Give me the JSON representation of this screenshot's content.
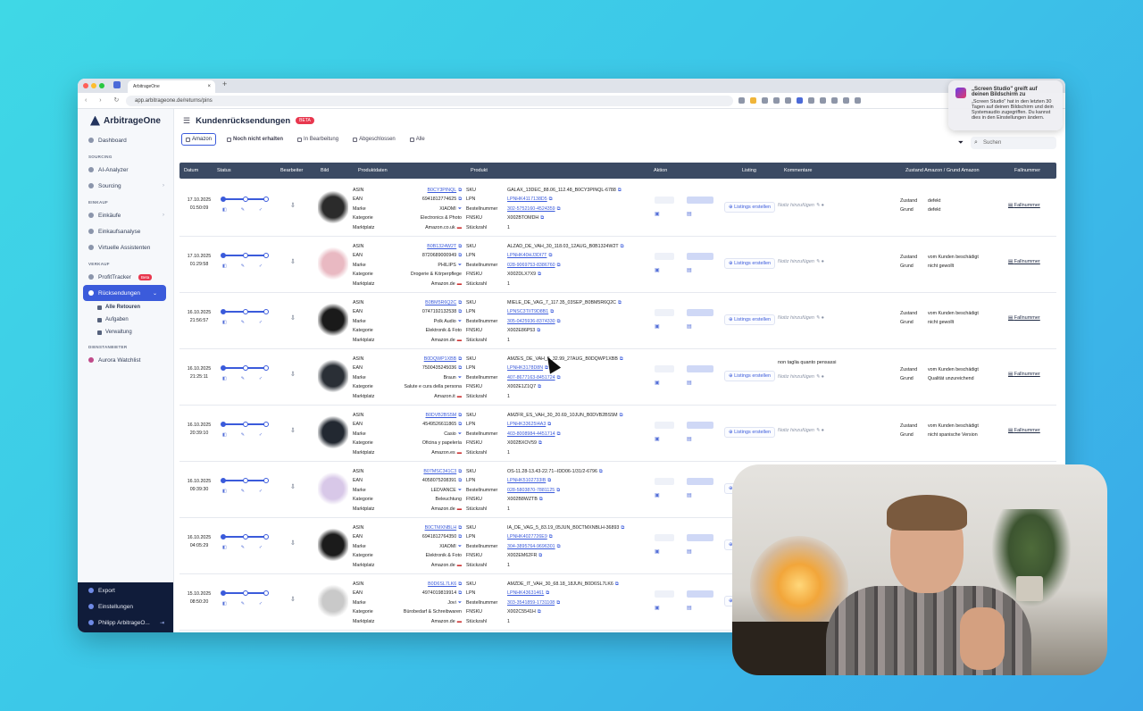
{
  "browser": {
    "tab_title": "ArbitrageOne",
    "url": "app.arbitrageone.de/returns/pins"
  },
  "sidebar": {
    "logo": "ArbitrageOne",
    "items": [
      {
        "label": "Dashboard"
      },
      {
        "section": "SOURCING"
      },
      {
        "label": "AI-Analyzer"
      },
      {
        "label": "Sourcing"
      },
      {
        "section": "EINKAUF"
      },
      {
        "label": "Einkäufe"
      },
      {
        "label": "Einkaufsanalyse"
      },
      {
        "label": "Virtuelle Assistenten"
      },
      {
        "section": "VERKAUF"
      },
      {
        "label": "ProfitTracker",
        "badge": "Beta"
      },
      {
        "label": "Rücksendungen"
      },
      {
        "label": "Alle Retouren"
      },
      {
        "label": "Aufgaben"
      },
      {
        "label": "Verwaltung"
      },
      {
        "section": "DIENSTANBIETER"
      },
      {
        "label": "Aurora Watchlist"
      }
    ],
    "bottom": [
      {
        "label": "Export"
      },
      {
        "label": "Einstellungen"
      },
      {
        "label": "Philipp ArbitrageO..."
      }
    ]
  },
  "page": {
    "title": "Kundenrücksendungen",
    "beta": "BETA",
    "filters": [
      "Amazon",
      "Noch nicht erhalten",
      "In Bearbeitung",
      "Abgeschlossen",
      "Alle"
    ],
    "search_placeholder": "Suchen"
  },
  "table": {
    "headers": [
      "Datum",
      "Status",
      "Bearbeiter",
      "Bild",
      "Produktdaten",
      "Produkt",
      "Aktion",
      "Listing",
      "Kommentare",
      "Zustand Amazon / Grund Amazon",
      "Fallnummer"
    ],
    "labels": {
      "asin": "ASIN",
      "ean": "EAN",
      "marke": "Marke",
      "kategorie": "Kategorie",
      "marktplatz": "Marktplatz",
      "sku": "SKU",
      "lpn": "LPN",
      "bestellnummer": "Bestellnummer",
      "fnsku": "FNSKU",
      "stueckzahl": "Stückzahl",
      "zustand": "Zustand",
      "grund": "Grund",
      "listing_btn": "Listings erstellen",
      "notiz": "Notiz hinzufügen",
      "fallnummer": "Fallnummer"
    },
    "rows": [
      {
        "date": "17.10.2025",
        "time": "01:50:09",
        "asin": "B0CY3PINQL",
        "ean": "6941812774625",
        "marke": "XIAOMI",
        "kategorie": "Electronics & Photo",
        "marktplatz": "Amazon.co.uk",
        "sku": "GALAX_13DEC_88.06_112.48_B0CY3PINQL-6788",
        "lpn": "LPNHK4117138D5",
        "bestellnummer": "302-5752160-4524359",
        "fnsku": "X002BTOMDH",
        "stueckzahl": "1",
        "kommentar": "",
        "zustand": "defekt",
        "grund": "defekt",
        "thumb": "#2b2b2b"
      },
      {
        "date": "17.10.2025",
        "time": "01:29:58",
        "asin": "B0B1324W2T",
        "ean": "8720689000949",
        "marke": "PHILIPS",
        "kategorie": "Drogerie & Körperpflege",
        "marktplatz": "Amazon.de",
        "sku": "ALZAD_DE_VAH_30_118.03_12AUG_B0B1324W2T",
        "lpn": "LPNHK40HJ3DI7T",
        "bestellnummer": "028-9069753-8386760",
        "fnsku": "X002DLX7X9",
        "stueckzahl": "1",
        "kommentar": "",
        "zustand": "vom Kunden beschädigt",
        "grund": "nicht gewollt",
        "thumb": "#e9b9c2"
      },
      {
        "date": "16.10.2025",
        "time": "21:56:57",
        "asin": "B0BM5R6Q2C",
        "ean": "0747192132538",
        "marke": "Polk Audio",
        "kategorie": "Elektronik & Foto",
        "marktplatz": "Amazon.de",
        "sku": "MIELE_DE_VAG_7_117.35_03SEP_B0BM5R6Q2C",
        "lpn": "LPNSC3TIIT9D8B1",
        "bestellnummer": "305-0425936-8374330",
        "fnsku": "X002E86P53",
        "stueckzahl": "1",
        "kommentar": "",
        "zustand": "vom Kunden beschädigt",
        "grund": "nicht gewollt",
        "thumb": "#1a1a1a"
      },
      {
        "date": "16.10.2025",
        "time": "21:25:11",
        "asin": "B0DQWP1XBB",
        "ean": "7500435245036",
        "marke": "Braun",
        "kategorie": "Salute e cura della persona",
        "marktplatz": "Amazon.it",
        "sku": "AMZES_DE_VAH_5_32.99_27AUG_B0DQWP1XBB",
        "lpn": "LPNHK3178D8N",
        "bestellnummer": "407-8677163-8451724",
        "fnsku": "X002E1Z1Q7",
        "stueckzahl": "1",
        "kommentar": "non taglia quanto pensassi",
        "zustand": "vom Kunden beschädigt",
        "grund": "Qualität unzureichend",
        "thumb": "#2a2f36"
      },
      {
        "date": "16.10.2025",
        "time": "20:39:10",
        "asin": "B0DVB2BS5M",
        "ean": "4549526611865",
        "marke": "Casio",
        "kategorie": "Oficina y papelería",
        "marktplatz": "Amazon.es",
        "sku": "AMZFR_ES_VAH_30_20.69_10JUN_B0DVB2BS5M",
        "lpn": "LPNHK33625I4A3",
        "bestellnummer": "403-8008984-4451714",
        "fnsku": "X002BXOV59",
        "stueckzahl": "1",
        "kommentar": "",
        "zustand": "vom Kunden beschädigt",
        "grund": "nicht spanische Version",
        "thumb": "#222831"
      },
      {
        "date": "16.10.2025",
        "time": "09:39:30",
        "asin": "B07MSC341C3",
        "ean": "4058075208391",
        "marke": "LEDVANCE",
        "kategorie": "Beleuchtung",
        "marktplatz": "Amazon.de",
        "sku": "OS-11.28-13.43-22.71--IDD06-1/31/2-6796",
        "lpn": "LPNHK5102733IB",
        "bestellnummer": "028-5803870-7881125",
        "fnsku": "X002B8WZTB",
        "stueckzahl": "1",
        "kommentar": "",
        "zustand": "",
        "grund": "",
        "thumb": "#d8c8e8"
      },
      {
        "date": "16.10.2025",
        "time": "04:05:29",
        "asin": "B0CTMXNBLH",
        "ean": "6941812764350",
        "marke": "XIAOMI",
        "kategorie": "Elektronik & Foto",
        "marktplatz": "Amazon.de",
        "sku": "IA_DE_VAG_5_83.19_05JUN_B0CTMXNBLH-36893",
        "lpn": "LPNHK4027726E9",
        "bestellnummer": "304-3895764-9696301",
        "fnsku": "X002EM62FR",
        "stueckzahl": "1",
        "kommentar": "",
        "zustand": "",
        "grund": "",
        "thumb": "#1b1b1b"
      },
      {
        "date": "15.10.2025",
        "time": "08:50:20",
        "asin": "B0D6SL7LK6",
        "ean": "4974019819914",
        "marke": "Jovi",
        "kategorie": "Bürobedarf & Schreibwaren",
        "marktplatz": "Amazon.de",
        "sku": "AMZDE_IT_VAH_30_68.18_18JUN_B0D6SL7LK6",
        "lpn": "LPNHK43631461",
        "bestellnummer": "303-3541859-1731108",
        "fnsku": "X002C5541H",
        "stueckzahl": "1",
        "kommentar": "",
        "zustand": "",
        "grund": "",
        "thumb": "#c9c9c9"
      }
    ]
  },
  "notification": {
    "title": "„Screen Studio\" greift auf deinen Bildschirm zu",
    "body": "„Screen Studio\" hat in den letzten 30 Tagen auf deinen Bildschirm und dein Systemaudio zugegriffen. Du kannst dies in den Einstellungen ändern."
  },
  "colors": {
    "accent": "#3b5bdb",
    "header_bg": "#3b4a63",
    "sidebar_bottom": "#101c3a",
    "beta": "#e8374e"
  }
}
